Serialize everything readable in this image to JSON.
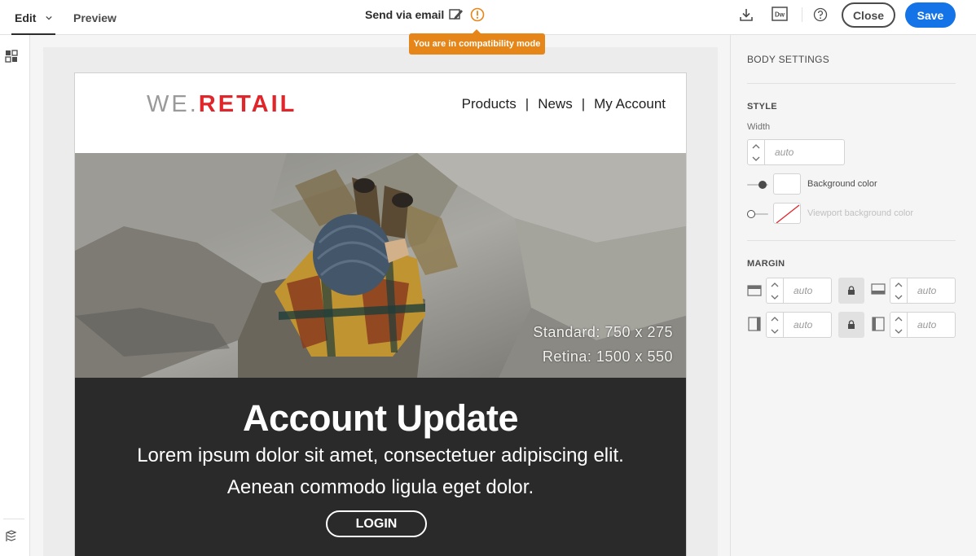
{
  "toolbar": {
    "tab_edit": "Edit",
    "tab_preview": "Preview",
    "title": "Send via email",
    "compat_tooltip": "You are in compatibility mode",
    "dw_label": "Dw",
    "close_label": "Close",
    "save_label": "Save"
  },
  "email": {
    "logo": {
      "we": "WE",
      "dot": ".",
      "retail": "RETAIL"
    },
    "nav": [
      "Products",
      "|",
      "News",
      "|",
      "My Account"
    ],
    "hero_standard": "Standard: 750 x 275",
    "hero_retina": "Retina: 1500 x 550",
    "headline": "Account Update",
    "body_line1": "Lorem ipsum dolor sit amet, consectetuer adipiscing elit.",
    "body_line2": "Aenean commodo ligula eget dolor.",
    "login_label": "LOGIN"
  },
  "panel": {
    "title": "BODY SETTINGS",
    "style_section": "STYLE",
    "width_label": "Width",
    "width_value": "auto",
    "bg_color_label": "Background color",
    "viewport_bg_label": "Viewport background color",
    "margin_section": "MARGIN",
    "margin_top": "auto",
    "margin_bottom": "auto",
    "margin_left": "auto",
    "margin_right": "auto"
  },
  "colors": {
    "accent": "#1473e6",
    "warning": "#e68619",
    "logo_red": "#e0262b"
  }
}
